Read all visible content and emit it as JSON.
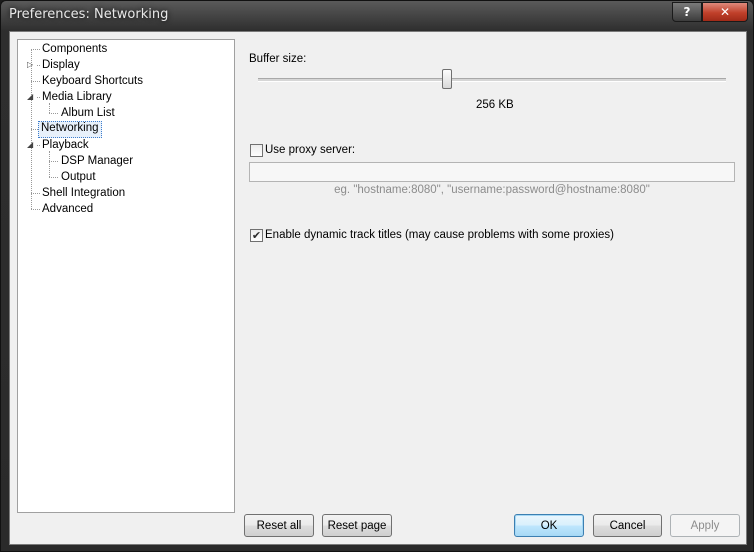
{
  "window": {
    "title": "Preferences: Networking",
    "help_label": "?",
    "close_label": "✕"
  },
  "tree": [
    {
      "label": "Components"
    },
    {
      "label": "Display"
    },
    {
      "label": "Keyboard Shortcuts"
    },
    {
      "label": "Media Library"
    },
    {
      "label": "Album List"
    },
    {
      "label": "Networking"
    },
    {
      "label": "Playback"
    },
    {
      "label": "DSP Manager"
    },
    {
      "label": "Output"
    },
    {
      "label": "Shell Integration"
    },
    {
      "label": "Advanced"
    }
  ],
  "tree_expanders": {
    "collapsed": "▷",
    "expanded": "◢"
  },
  "buffer": {
    "label": "Buffer size:",
    "value_text": "256 KB"
  },
  "proxy": {
    "label": "Use proxy server:",
    "checked": false,
    "value": "",
    "hint": "eg. \"hostname:8080\", \"username:password@hostname:8080\""
  },
  "dynamic_titles": {
    "label": "Enable dynamic track titles (may cause problems with some proxies)",
    "check_glyph": "✔"
  },
  "buttons": {
    "reset_all": "Reset all",
    "reset_page": "Reset page",
    "ok": "OK",
    "cancel": "Cancel",
    "apply": "Apply"
  }
}
